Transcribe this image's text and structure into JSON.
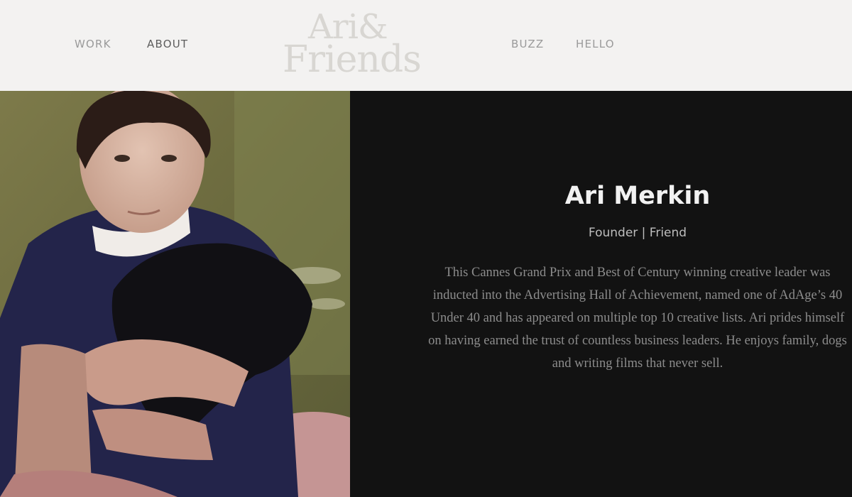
{
  "header": {
    "logo_line1": "Ari&",
    "logo_line2": "Friends",
    "nav": {
      "work": "WORK",
      "about": "ABOUT",
      "buzz": "BUZZ",
      "hello": "HELLO"
    }
  },
  "profile": {
    "name": "Ari Merkin",
    "role": "Founder | Friend",
    "bio": "This Cannes Grand Prix and Best of Century winning creative leader was inducted into the Advertising Hall of Achievement, named one of AdAge’s 40 Under 40 and has appeared on multiple top 10 creative lists. Ari prides himself on having earned the trust of countless business leaders. He enjoys family, dogs and writing films that never sell."
  },
  "colors": {
    "header_bg": "#f3f2f1",
    "panel_bg": "#121212",
    "nav_text": "#9a9a9a",
    "nav_active": "#5d5d5d"
  }
}
